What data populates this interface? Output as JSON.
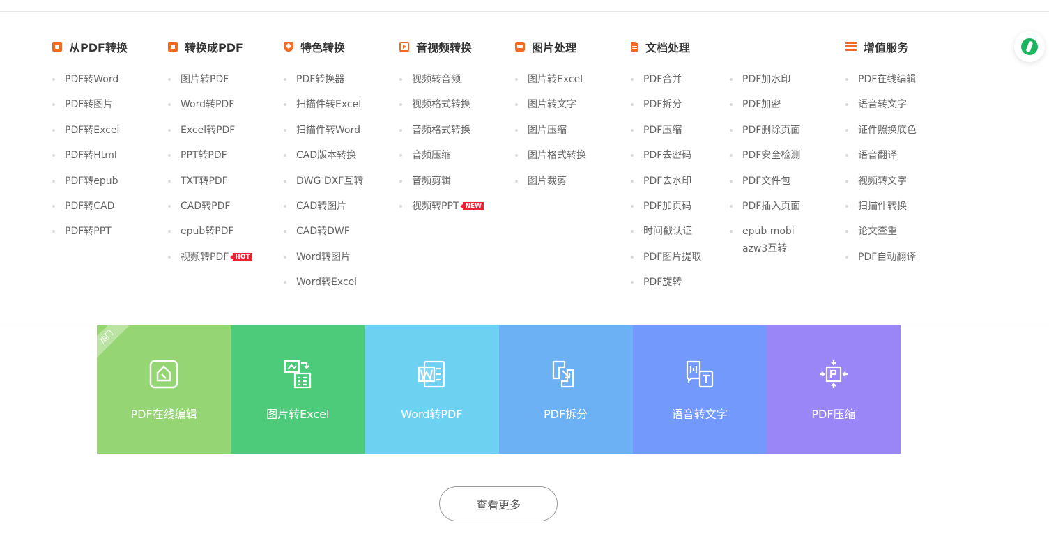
{
  "columns": [
    {
      "key": "from-pdf",
      "title": "从PDF转换",
      "icon": "from-pdf-icon",
      "items": [
        {
          "label": "PDF转Word"
        },
        {
          "label": "PDF转图片"
        },
        {
          "label": "PDF转Excel"
        },
        {
          "label": "PDF转Html"
        },
        {
          "label": "PDF转epub"
        },
        {
          "label": "PDF转CAD"
        },
        {
          "label": "PDF转PPT"
        }
      ]
    },
    {
      "key": "to-pdf",
      "title": "转换成PDF",
      "icon": "to-pdf-icon",
      "items": [
        {
          "label": "图片转PDF"
        },
        {
          "label": "Word转PDF"
        },
        {
          "label": "Excel转PDF"
        },
        {
          "label": "PPT转PDF"
        },
        {
          "label": "TXT转PDF"
        },
        {
          "label": "CAD转PDF"
        },
        {
          "label": "epub转PDF"
        },
        {
          "label": "视频转PDF",
          "badge": "HOT"
        }
      ]
    },
    {
      "key": "special",
      "title": "特色转换",
      "icon": "shield-icon",
      "items": [
        {
          "label": "PDF转换器"
        },
        {
          "label": "扫描件转Excel"
        },
        {
          "label": "扫描件转Word"
        },
        {
          "label": "CAD版本转换"
        },
        {
          "label": "DWG DXF互转"
        },
        {
          "label": "CAD转图片"
        },
        {
          "label": "CAD转DWF"
        },
        {
          "label": "Word转图片"
        },
        {
          "label": "Word转Excel"
        }
      ]
    },
    {
      "key": "av",
      "title": "音视频转换",
      "icon": "media-icon",
      "items": [
        {
          "label": "视频转音频"
        },
        {
          "label": "视频格式转换"
        },
        {
          "label": "音频格式转换"
        },
        {
          "label": "音频压缩"
        },
        {
          "label": "音频剪辑"
        },
        {
          "label": "视频转PPT",
          "badge": "NEW"
        }
      ]
    },
    {
      "key": "image",
      "title": "图片处理",
      "icon": "image-icon",
      "items": [
        {
          "label": "图片转Excel"
        },
        {
          "label": "图片转文字"
        },
        {
          "label": "图片压缩"
        },
        {
          "label": "图片格式转换"
        },
        {
          "label": "图片裁剪"
        }
      ]
    },
    {
      "key": "doc",
      "title": "文档处理",
      "icon": "document-icon",
      "items": [
        {
          "label": "PDF合并"
        },
        {
          "label": "PDF拆分"
        },
        {
          "label": "PDF压缩"
        },
        {
          "label": "PDF去密码"
        },
        {
          "label": "PDF去水印"
        },
        {
          "label": "PDF加页码"
        },
        {
          "label": "时间戳认证"
        },
        {
          "label": "PDF图片提取"
        },
        {
          "label": "PDF旋转"
        }
      ]
    },
    {
      "key": "doc2",
      "title": "",
      "icon": "",
      "items": [
        {
          "label": "PDF加水印"
        },
        {
          "label": "PDF加密"
        },
        {
          "label": "PDF删除页面"
        },
        {
          "label": "PDF安全检测"
        },
        {
          "label": "PDF文件包"
        },
        {
          "label": "PDF插入页面"
        },
        {
          "label": "epub mobi azw3互转",
          "wrap": true
        }
      ]
    },
    {
      "key": "value",
      "title": "增值服务",
      "icon": "list-icon",
      "items": [
        {
          "label": "PDF在线编辑"
        },
        {
          "label": "语音转文字"
        },
        {
          "label": "证件照换底色"
        },
        {
          "label": "语音翻译"
        },
        {
          "label": "视频转文字"
        },
        {
          "label": "扫描件转换"
        },
        {
          "label": "论文查重"
        },
        {
          "label": "PDF自动翻译"
        }
      ]
    }
  ],
  "tiles": [
    {
      "label": "PDF在线编辑",
      "color": "#95d574",
      "icon": "edit-icon",
      "ribbon": "热门"
    },
    {
      "label": "图片转Excel",
      "color": "#4ecb7a",
      "icon": "image-to-excel-icon"
    },
    {
      "label": "Word转PDF",
      "color": "#6dd1f2",
      "icon": "word-icon"
    },
    {
      "label": "PDF拆分",
      "color": "#6cb1f4",
      "icon": "split-icon"
    },
    {
      "label": "语音转文字",
      "color": "#7299fb",
      "icon": "speech-to-text-icon"
    },
    {
      "label": "PDF压缩",
      "color": "#9a86f7",
      "icon": "compress-icon"
    }
  ],
  "more_button": "查看更多",
  "colors": {
    "accent": "#f26a22",
    "badge": "#ee2233",
    "float": "#1db45f"
  }
}
